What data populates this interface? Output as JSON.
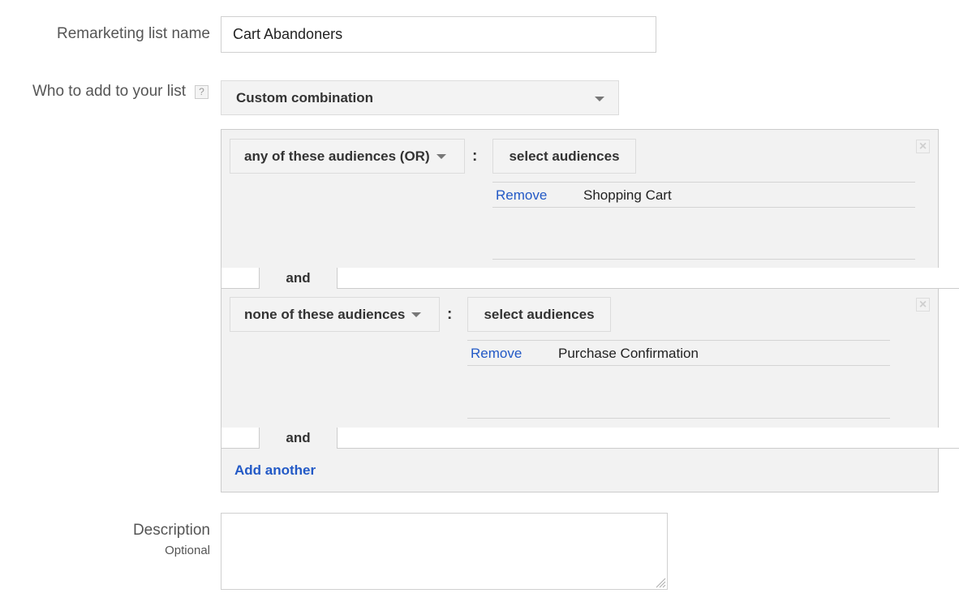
{
  "form": {
    "name_label": "Remarketing list name",
    "name_value": "Cart Abandoners",
    "who_label": "Who to add to your list",
    "help_icon": "?",
    "who_select": "Custom combination",
    "description_label": "Description",
    "description_sublabel": "Optional",
    "description_value": ""
  },
  "groups": [
    {
      "operator": "any of these audiences (OR)",
      "colon": ":",
      "select_label": "select audiences",
      "items": [
        {
          "action": "Remove",
          "name": "Shopping Cart"
        }
      ],
      "close_icon": "×"
    },
    {
      "operator": "none of these audiences",
      "colon": ":",
      "select_label": "select audiences",
      "items": [
        {
          "action": "Remove",
          "name": "Purchase Confirmation"
        }
      ],
      "close_icon": "×"
    }
  ],
  "connectors": [
    "and",
    "and"
  ],
  "add_another": "Add another",
  "colors": {
    "link": "#2259c6",
    "panel": "#f2f2f2",
    "border": "#cccccc"
  }
}
